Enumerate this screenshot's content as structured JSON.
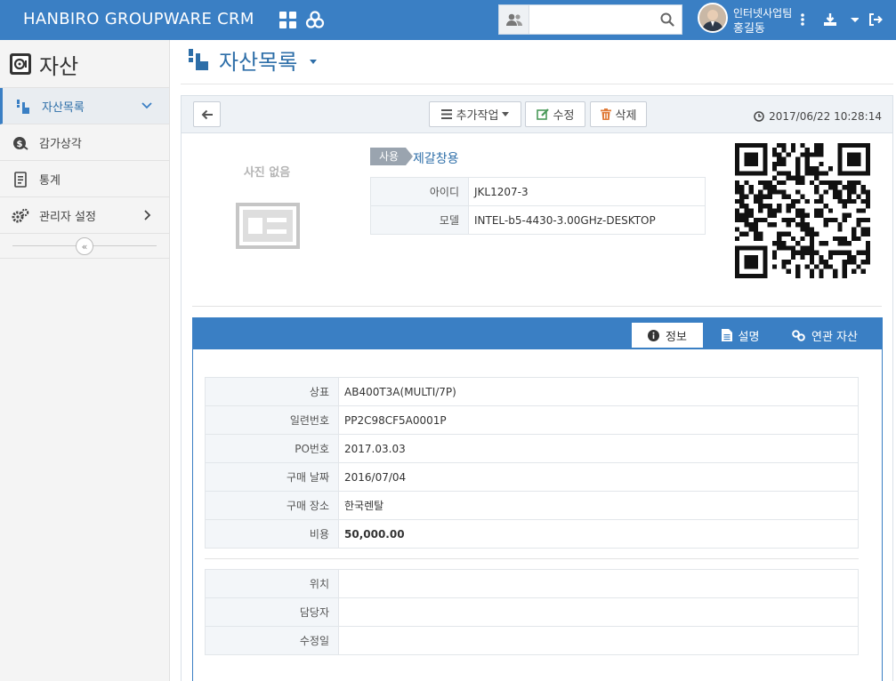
{
  "header": {
    "brand": "HANBIRO GROUPWARE CRM",
    "search": {
      "value": "",
      "placeholder": ""
    },
    "user": {
      "company": "인터넷사업팀",
      "name": "홍길동"
    }
  },
  "sidebar": {
    "title": "자산",
    "items": [
      {
        "label": "자산목록"
      },
      {
        "label": "감가상각"
      },
      {
        "label": "통계"
      },
      {
        "label": "관리자 설정"
      }
    ]
  },
  "page": {
    "title": "자산목록"
  },
  "toolbar": {
    "more_actions_label": "추가작업",
    "edit_label": "수정",
    "delete_label": "삭제",
    "timestamp": "2017/06/22 10:28:14"
  },
  "asset": {
    "no_photo_label": "사진 없음",
    "status_badge": "사용",
    "status_name": "제갈창용",
    "summary": [
      {
        "key": "아이디",
        "value": "JKL1207-3"
      },
      {
        "key": "모델",
        "value": "INTEL-b5-4430-3.00GHz-DESKTOP"
      }
    ]
  },
  "tabs": [
    {
      "label": "정보",
      "icon": "info-circle-icon"
    },
    {
      "label": "설명",
      "icon": "file-icon"
    },
    {
      "label": "연관 자산",
      "icon": "link-icon"
    }
  ],
  "details": [
    {
      "key": "상표",
      "value": "AB400T3A(MULTI/7P)"
    },
    {
      "key": "일련번호",
      "value": "PP2C98CF5A0001P"
    },
    {
      "key": "PO번호",
      "value": "2017.03.03"
    },
    {
      "key": "구매 날짜",
      "value": "2016/07/04"
    },
    {
      "key": "구매 장소",
      "value": "한국렌탈"
    },
    {
      "key": "비용",
      "value": "50,000.00"
    }
  ],
  "details_extra": [
    {
      "key": "위치",
      "value": ""
    },
    {
      "key": "담당자",
      "value": ""
    },
    {
      "key": "수정일",
      "value": ""
    }
  ],
  "colors": {
    "brand_blue": "#3a7fc4",
    "link_blue": "#2d6ea8",
    "delete_orange": "#e07b39",
    "edit_green": "#4a9a5a"
  }
}
